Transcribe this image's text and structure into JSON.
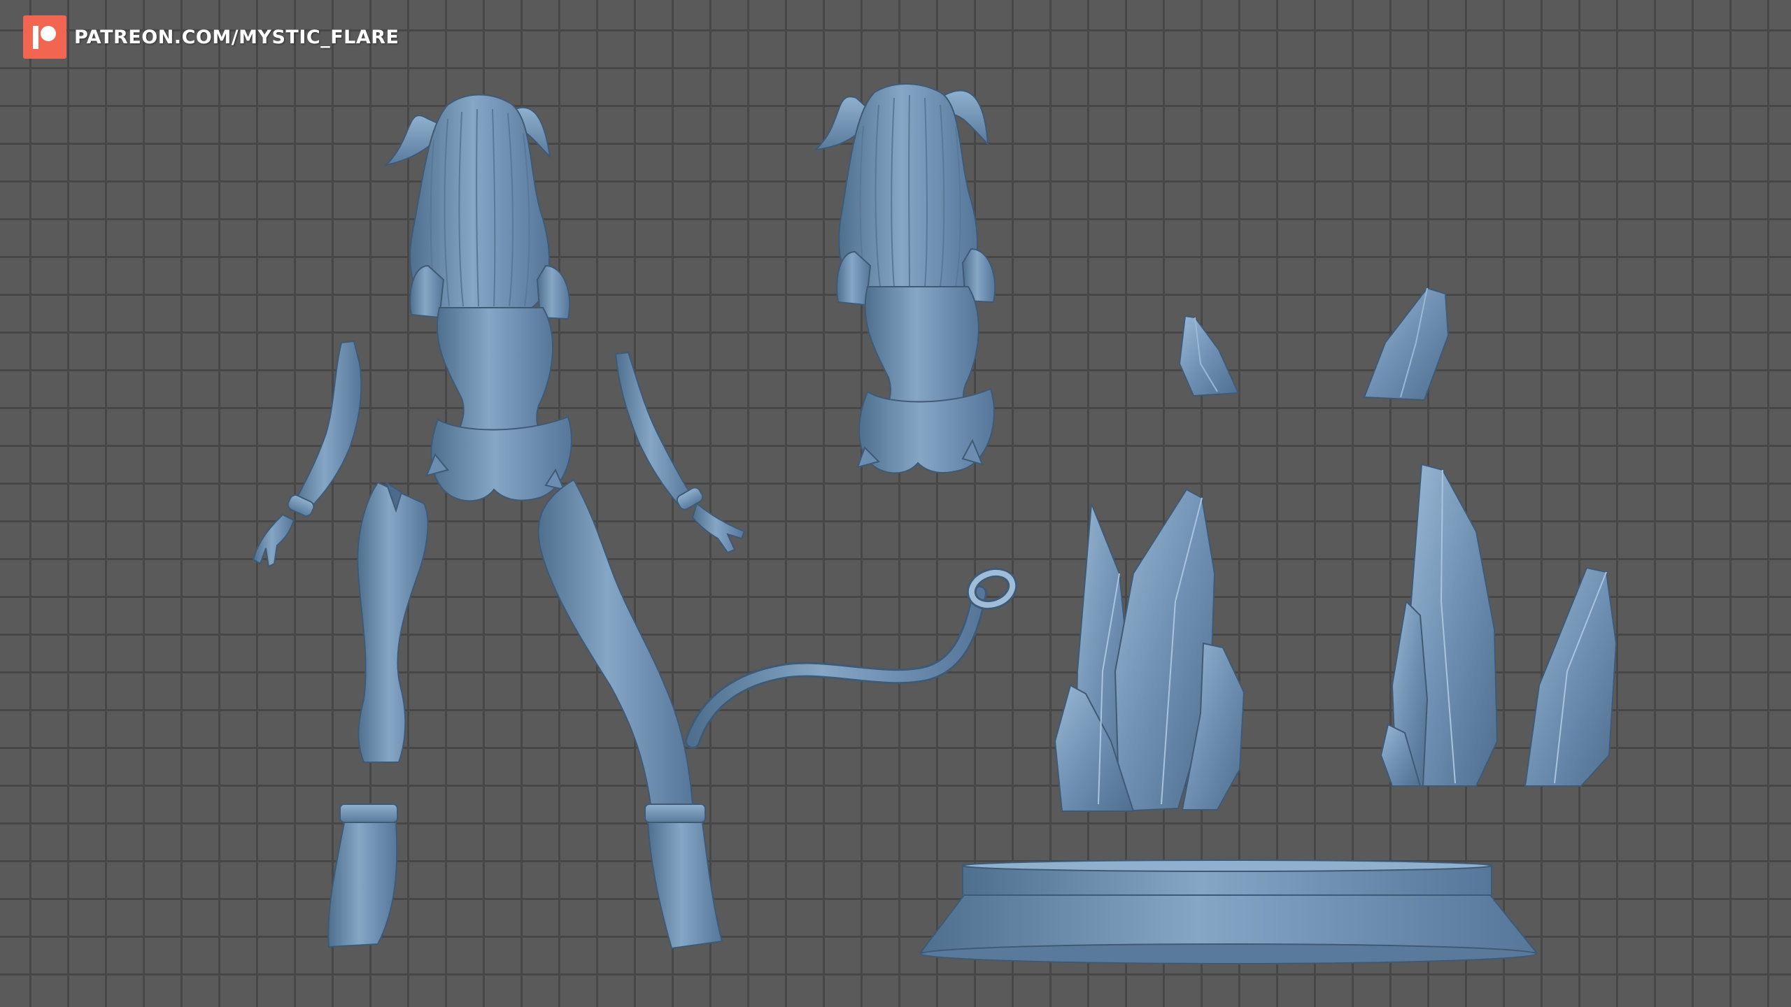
{
  "watermark": {
    "text": "PATREON.COM/MYSTIC_FLARE",
    "logo_icon": "patreon-logo-icon",
    "logo_color": "#f26651"
  },
  "viewport": {
    "background_color": "#5a5a5a",
    "grid_color": "#474747",
    "model_color": "#7494b4"
  },
  "parts": [
    "figure-back-full",
    "left-arm",
    "right-arm",
    "left-leg",
    "right-leg",
    "torso-duplicate",
    "tail",
    "small-crystal-left",
    "small-crystal-right",
    "crystal-cluster-left",
    "crystal-cluster-right",
    "round-base"
  ]
}
